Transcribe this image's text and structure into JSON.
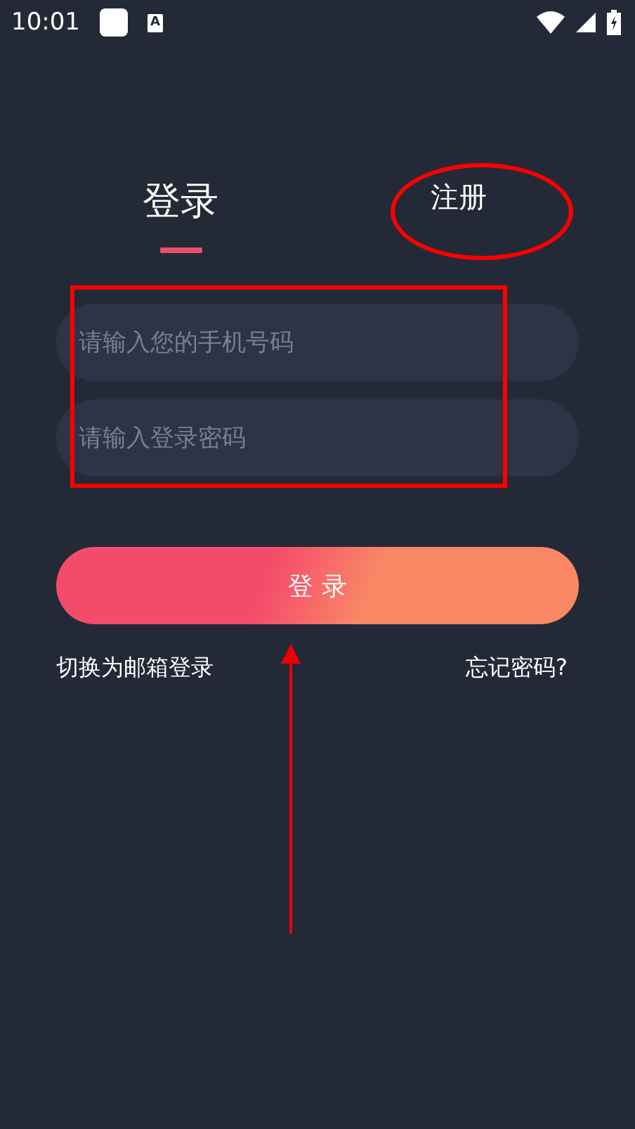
{
  "status_bar": {
    "time": "10:01",
    "notification_letter": "A"
  },
  "tabs": [
    {
      "label": "登录",
      "selected": true
    },
    {
      "label": "注册",
      "selected": false
    }
  ],
  "fields": [
    {
      "placeholder": "请输入您的手机号码"
    },
    {
      "placeholder": "请输入登录密码"
    }
  ],
  "login_button": "登 录",
  "links": {
    "switch_to_email": "切换为邮箱登录",
    "forgot_password": "忘记密码?"
  }
}
